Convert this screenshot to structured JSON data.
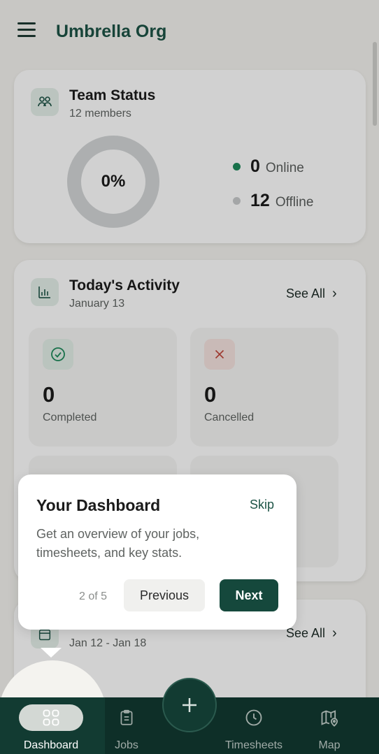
{
  "header": {
    "title": "Umbrella Org"
  },
  "team_status": {
    "title": "Team Status",
    "subtitle": "12 members",
    "percent_label": "0%",
    "online_count": "0",
    "online_label": "Online",
    "offline_count": "12",
    "offline_label": "Offline",
    "colors": {
      "online": "#1e8a5b",
      "offline": "#c9cbcc"
    }
  },
  "activity": {
    "title": "Today's Activity",
    "date": "January 13",
    "see_all": "See All",
    "stats": [
      {
        "value": "0",
        "label": "Completed",
        "icon": "check-circle-icon"
      },
      {
        "value": "0",
        "label": "Cancelled",
        "icon": "x-icon"
      }
    ]
  },
  "weekly": {
    "date_range": "Jan 12 - Jan 18",
    "see_all": "See All"
  },
  "tour": {
    "title": "Your Dashboard",
    "skip": "Skip",
    "body": "Get an overview of your jobs, timesheets, and key stats.",
    "step": "2 of 5",
    "previous": "Previous",
    "next": "Next"
  },
  "nav": {
    "dashboard": "Dashboard",
    "jobs": "Jobs",
    "timesheets": "Timesheets",
    "map": "Map"
  }
}
